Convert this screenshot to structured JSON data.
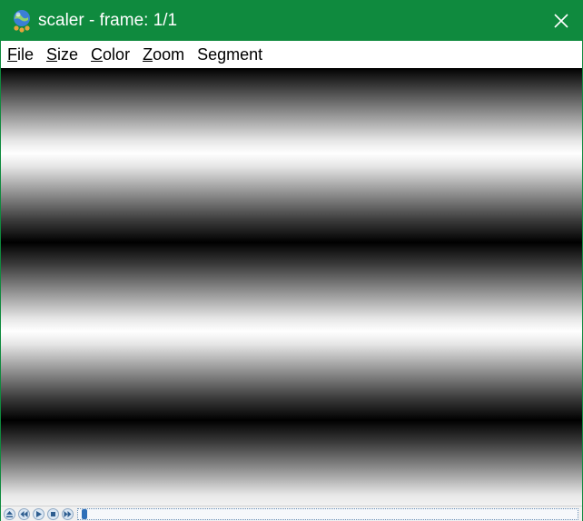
{
  "window": {
    "title": "scaler - frame: 1/1",
    "accent_color": "#0f8a3e",
    "icons": {
      "app": "globe-app-icon",
      "close": "close-icon"
    }
  },
  "menu": {
    "items": [
      {
        "mnemonic": "F",
        "rest": "ile"
      },
      {
        "mnemonic": "S",
        "rest": "ize"
      },
      {
        "mnemonic": "C",
        "rest": "olor"
      },
      {
        "mnemonic": "Z",
        "rest": "oom"
      },
      {
        "mnemonic": "",
        "rest": "Segment"
      }
    ]
  },
  "canvas": {
    "content": "horizontal grayscale sine bands"
  },
  "playback": {
    "icons": [
      "eject-icon",
      "rewind-icon",
      "play-icon",
      "stop-icon",
      "fast-forward-icon"
    ],
    "slider_position": 0
  }
}
